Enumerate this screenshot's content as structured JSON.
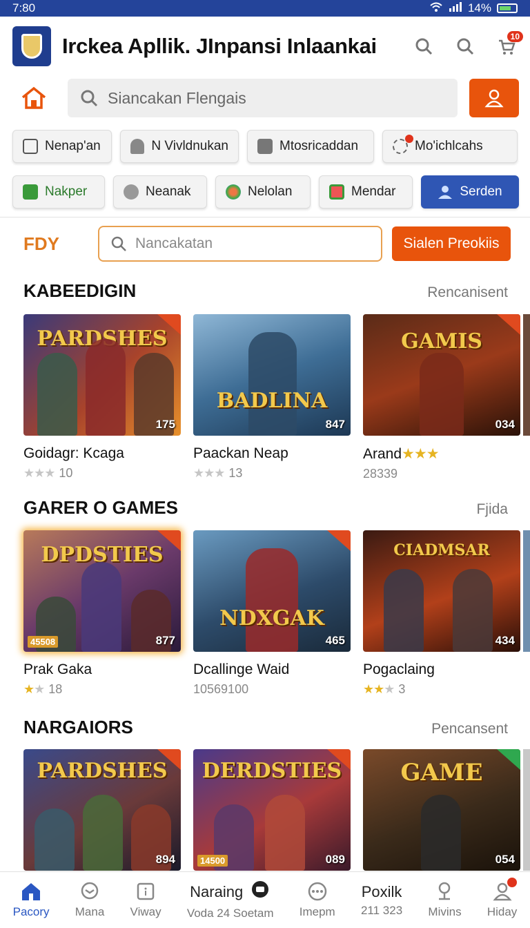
{
  "status_bar": {
    "time": "7:80",
    "battery": "14%"
  },
  "header": {
    "title": "Irckea Apllik. JInpansi Inlaankai",
    "cart_badge": "10"
  },
  "search": {
    "placeholder": "Siancakan Flengais"
  },
  "categories_row1": [
    {
      "label": "Nenap'an",
      "icon": "window-icon"
    },
    {
      "label": "N Vivldnukan",
      "icon": "person-icon"
    },
    {
      "label": "Mtosricaddan",
      "icon": "folder-icon"
    },
    {
      "label": "Mo'ichlcahs",
      "icon": "gear-icon"
    }
  ],
  "categories_row2": [
    {
      "label": "Nakper",
      "icon": "green-box-icon"
    },
    {
      "label": "Neanak",
      "icon": "group-icon"
    },
    {
      "label": "Nelolan",
      "icon": "sparkle-icon"
    },
    {
      "label": "Mendar",
      "icon": "calendar-icon"
    },
    {
      "label": "Serden",
      "icon": "user-icon"
    }
  ],
  "fdy": {
    "label": "FDY",
    "placeholder": "Nancakatan",
    "button": "Sialen Preokiis"
  },
  "sections": [
    {
      "title": "KABEEDIGIN",
      "link": "Rencanisent",
      "cards": [
        {
          "art": "PARDSHES",
          "count": "175",
          "name": "Goidagr: Kcaga",
          "stars_on": 0,
          "stars_off": 3,
          "meta": "10"
        },
        {
          "art": "BADLINA",
          "count": "847",
          "name": "Paackan Neap",
          "stars_on": 0,
          "stars_off": 3,
          "meta": "13"
        },
        {
          "art": "GAMIS",
          "count": "034",
          "name": "Arand",
          "stars_on": 3,
          "stars_off": 0,
          "meta": "28339"
        }
      ]
    },
    {
      "title": "GARER O GAMES",
      "link": "Fjida",
      "cards": [
        {
          "art": "DPDSTIES",
          "count": "877",
          "chip": "45508",
          "name": "Prak Gaka",
          "stars_on": 1,
          "stars_off": 1,
          "meta": "18"
        },
        {
          "art": "NDXGAK",
          "count": "465",
          "name": "Dcallinge Waid",
          "stars_on": 0,
          "stars_off": 0,
          "meta": "10569100"
        },
        {
          "art": "CIADMSAR",
          "count": "434",
          "name": "Pogaclaing",
          "stars_on": 2,
          "stars_off": 1,
          "meta": "3"
        }
      ]
    },
    {
      "title": "NARGAIORS",
      "link": "Pencansent",
      "cards": [
        {
          "art": "PARDSHES",
          "count": "894",
          "name": "",
          "stars_on": 0,
          "stars_off": 0,
          "meta": ""
        },
        {
          "art": "DERDSTIES",
          "count": "089",
          "chip": "14500",
          "name": "",
          "stars_on": 0,
          "stars_off": 0,
          "meta": ""
        },
        {
          "art": "GAME",
          "count": "054",
          "name": "",
          "stars_on": 0,
          "stars_off": 0,
          "meta": ""
        }
      ]
    }
  ],
  "bottom_nav": [
    {
      "label": "Pacory",
      "icon": "home-icon"
    },
    {
      "label": "Mana",
      "icon": "chat-icon"
    },
    {
      "label": "Viway",
      "icon": "square-icon"
    },
    {
      "label": "Naraing",
      "sub": "Voda 24 Soetam",
      "icon": "message-icon"
    },
    {
      "label": "Imepm",
      "icon": "more-icon"
    },
    {
      "label": "Poxilk",
      "sub": "211 323"
    },
    {
      "label": "Mivins",
      "icon": "pin-icon"
    },
    {
      "label": "Hiday",
      "icon": "profile-icon"
    }
  ],
  "colors": {
    "accent_orange": "#e8540c",
    "primary_blue": "#2f56b4",
    "status_bar": "#24449a"
  }
}
